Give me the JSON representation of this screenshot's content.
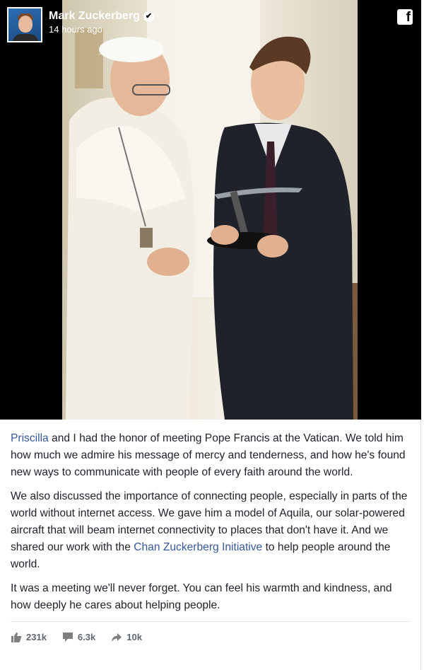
{
  "author": {
    "name": "Mark Zuckerberg",
    "verified": true,
    "time": "14 hours ago"
  },
  "icons": {
    "avatar": "profile-photo",
    "verified": "check-badge-icon",
    "logo": "facebook-icon",
    "like": "thumbs-up-icon",
    "comment": "comment-icon",
    "share": "share-arrow-icon"
  },
  "post": {
    "p1_link": "Priscilla",
    "p1_text": " and I had the honor of meeting Pope Francis at the Vatican. We told him how much we admire his message of mercy and tenderness, and how he's found new ways to communicate with people of every faith around the world.",
    "p2_before": "We also discussed the importance of connecting people, especially in parts of the world without internet access. We gave him a model of Aquila, our solar-powered aircraft that will beam internet connectivity to places that don't have it. And we shared our work with the ",
    "p2_link": "Chan Zuckerberg Initiative",
    "p2_after": " to help people around the world.",
    "p3": "It was a meeting we'll never forget. You can feel his warmth and kindness, and how deeply he cares about helping people."
  },
  "stats": {
    "likes": "231k",
    "comments": "6.3k",
    "shares": "10k"
  },
  "colors": {
    "link": "#365899",
    "text": "#1d2129",
    "meta": "#606770"
  }
}
